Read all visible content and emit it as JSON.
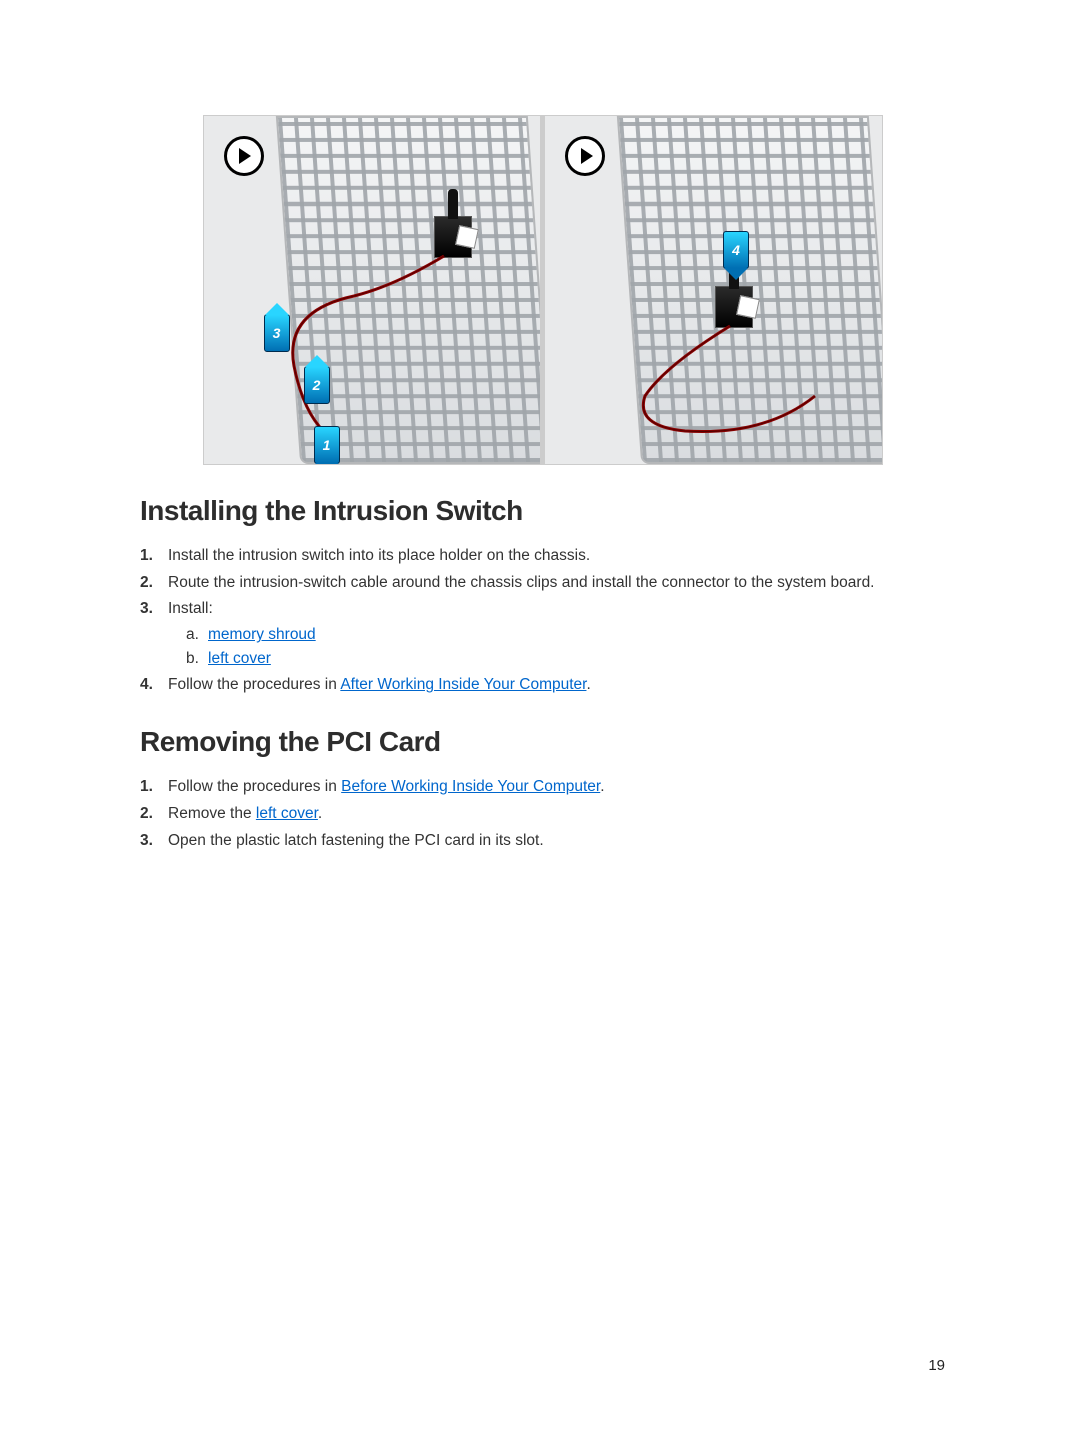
{
  "page_number": "19",
  "section1": {
    "heading": "Installing the Intrusion Switch",
    "steps": [
      {
        "text": "Install the intrusion switch into its place holder on the chassis."
      },
      {
        "text": "Route the intrusion-switch cable around the chassis clips and install the connector to the system board."
      },
      {
        "text": "Install:",
        "sub": [
          {
            "link": "memory shroud"
          },
          {
            "link": "left cover"
          }
        ]
      },
      {
        "prefix": "Follow the procedures in ",
        "link": "After Working Inside Your Computer",
        "suffix": "."
      }
    ]
  },
  "section2": {
    "heading": "Removing the PCI Card",
    "steps": [
      {
        "prefix": "Follow the procedures in ",
        "link": "Before Working Inside Your Computer",
        "suffix": "."
      },
      {
        "prefix": "Remove the ",
        "link": "left cover",
        "suffix": "."
      },
      {
        "text": "Open the plastic latch fastening the PCI card in its slot."
      }
    ]
  },
  "figure": {
    "panels": 2,
    "arrows_left": [
      "1",
      "2",
      "3"
    ],
    "arrows_right": [
      "4"
    ]
  }
}
